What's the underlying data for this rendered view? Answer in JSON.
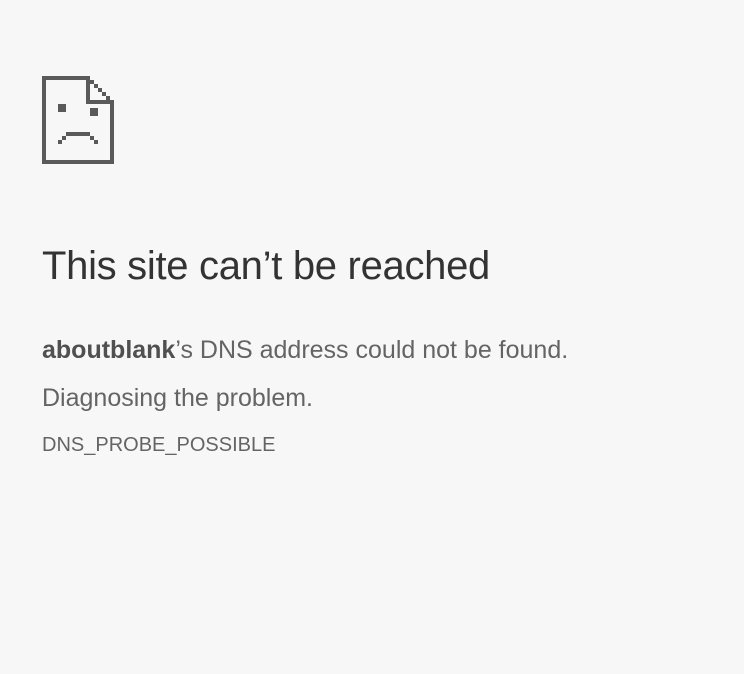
{
  "error_page": {
    "icon": "sad-page-icon",
    "heading": "This site can’t be reached",
    "summary": {
      "host": "aboutblank",
      "message": "’s DNS address could not be found."
    },
    "diagnosing": "Diagnosing the problem.",
    "error_code": "DNS_PROBE_POSSIBLE"
  },
  "colors": {
    "background": "#f7f7f7",
    "heading": "#333333",
    "body_text": "#646464",
    "icon": "#5a5a5a"
  }
}
